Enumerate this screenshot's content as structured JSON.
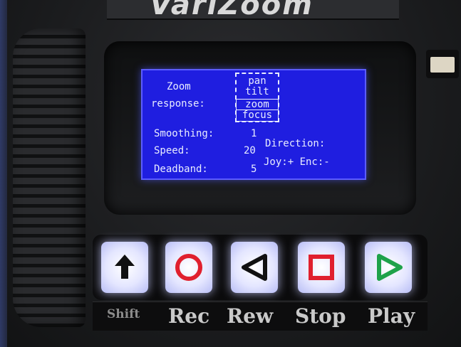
{
  "device": {
    "brand": "VariZoom"
  },
  "screen": {
    "title_line1": "Zoom",
    "title_line2": "response:",
    "menu_options": [
      "pan",
      "tilt",
      "zoom",
      "focus"
    ],
    "selected_option": "zoom focus",
    "smoothing_label": "Smoothing:",
    "smoothing_value": "1",
    "speed_label": "Speed:",
    "speed_value": "20",
    "deadband_label": "Deadband:",
    "deadband_value": "5",
    "direction_label": "Direction:",
    "direction_value": "Joy:+ Enc:-"
  },
  "buttons": [
    {
      "name": "shift",
      "label": "Shift",
      "icon": "up-arrow-icon",
      "color": "#111111"
    },
    {
      "name": "rec",
      "label": "Rec",
      "icon": "circle-icon",
      "color": "#e0202e"
    },
    {
      "name": "rew",
      "label": "Rew",
      "icon": "left-triangle-icon",
      "color": "#111111"
    },
    {
      "name": "stop",
      "label": "Stop",
      "icon": "square-icon",
      "color": "#e0202e"
    },
    {
      "name": "play",
      "label": "Play",
      "icon": "right-triangle-icon",
      "color": "#1fa24a"
    }
  ],
  "colors": {
    "lcd_background": "#1f1ee0",
    "lcd_text": "#e8ecff"
  }
}
